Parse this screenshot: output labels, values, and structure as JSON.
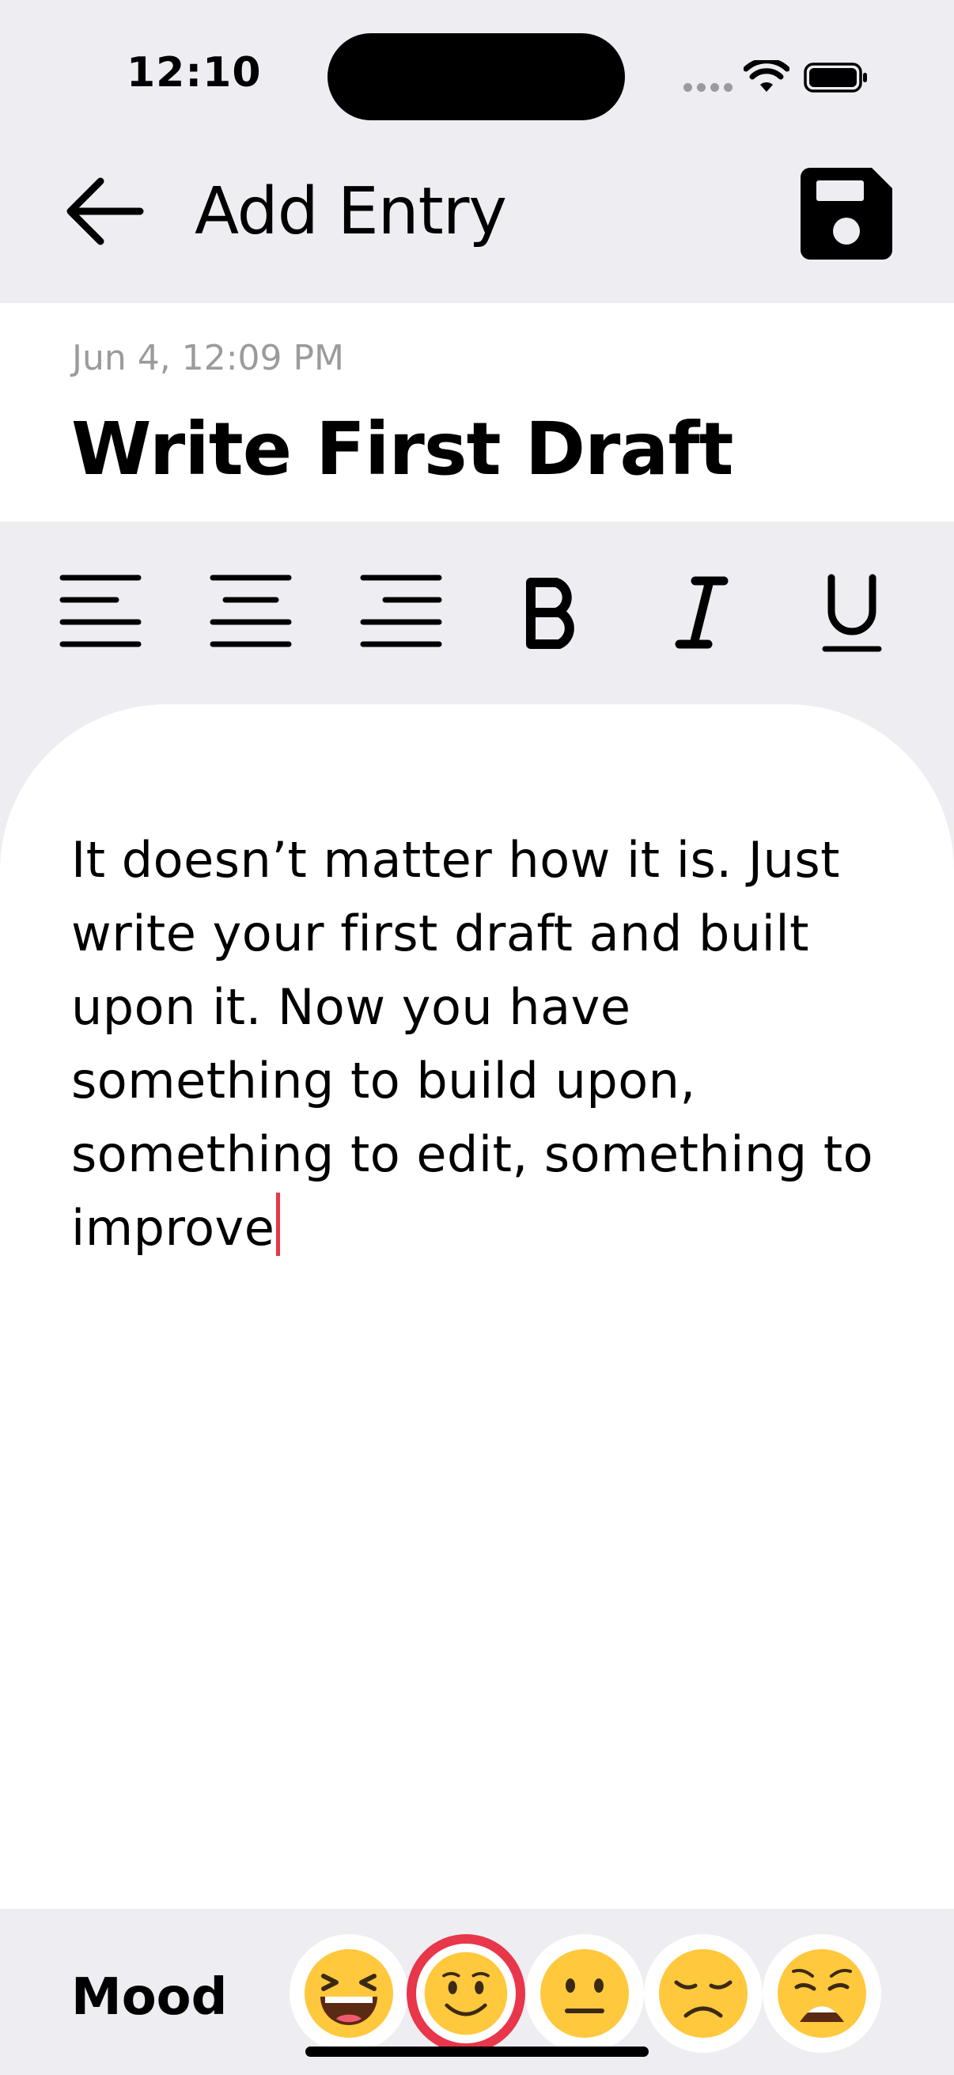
{
  "status_bar": {
    "time": "12:10"
  },
  "header": {
    "title": "Add Entry",
    "back_icon": "arrow-left-icon",
    "save_icon": "floppy-disk-icon"
  },
  "entry": {
    "date": "Jun 4, 12:09 PM",
    "title": "Write First Draft",
    "body": "It doesn’t matter how it is. Just write your first draft and built upon it. Now you have something to build upon, something to edit, something to improve"
  },
  "toolbar": {
    "buttons": [
      {
        "name": "align-left",
        "icon": "align-left-icon"
      },
      {
        "name": "align-center",
        "icon": "align-center-icon"
      },
      {
        "name": "align-right",
        "icon": "align-right-icon"
      },
      {
        "name": "bold",
        "icon": "bold-icon"
      },
      {
        "name": "italic",
        "icon": "italic-icon"
      },
      {
        "name": "underline",
        "icon": "underline-icon"
      }
    ]
  },
  "mood": {
    "label": "Mood",
    "options": [
      {
        "name": "laughing",
        "icon": "laughing-face-icon",
        "selected": false
      },
      {
        "name": "smiling",
        "icon": "smiling-face-icon",
        "selected": true
      },
      {
        "name": "neutral",
        "icon": "neutral-face-icon",
        "selected": false
      },
      {
        "name": "sad",
        "icon": "sad-face-icon",
        "selected": false
      },
      {
        "name": "weary",
        "icon": "weary-face-icon",
        "selected": false
      }
    ]
  },
  "colors": {
    "accent": "#E8364A",
    "background": "#EEEDF2",
    "card": "#FFFFFF",
    "muted_text": "#9B9B9B",
    "emoji_yellow": "#FFC83D"
  }
}
